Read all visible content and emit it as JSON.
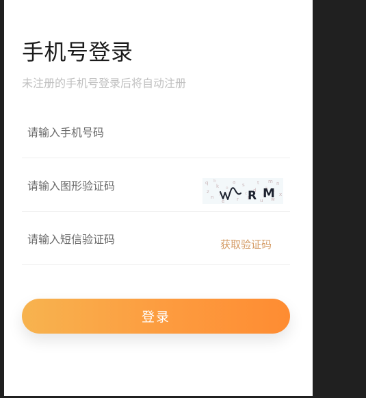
{
  "login": {
    "title": "手机号登录",
    "subtitle": "未注册的手机号登录后将自动注册",
    "phone_placeholder": "请输入手机号码",
    "captcha_placeholder": "请输入图形验证码",
    "captcha_text": "WRM",
    "sms_placeholder": "请输入短信验证码",
    "get_code_label": "获取验证码",
    "submit_label": "登录"
  },
  "colors": {
    "accent": "#fe8c32",
    "accent_light": "#f7b34f",
    "link": "#d49a63",
    "background": "#202020"
  }
}
